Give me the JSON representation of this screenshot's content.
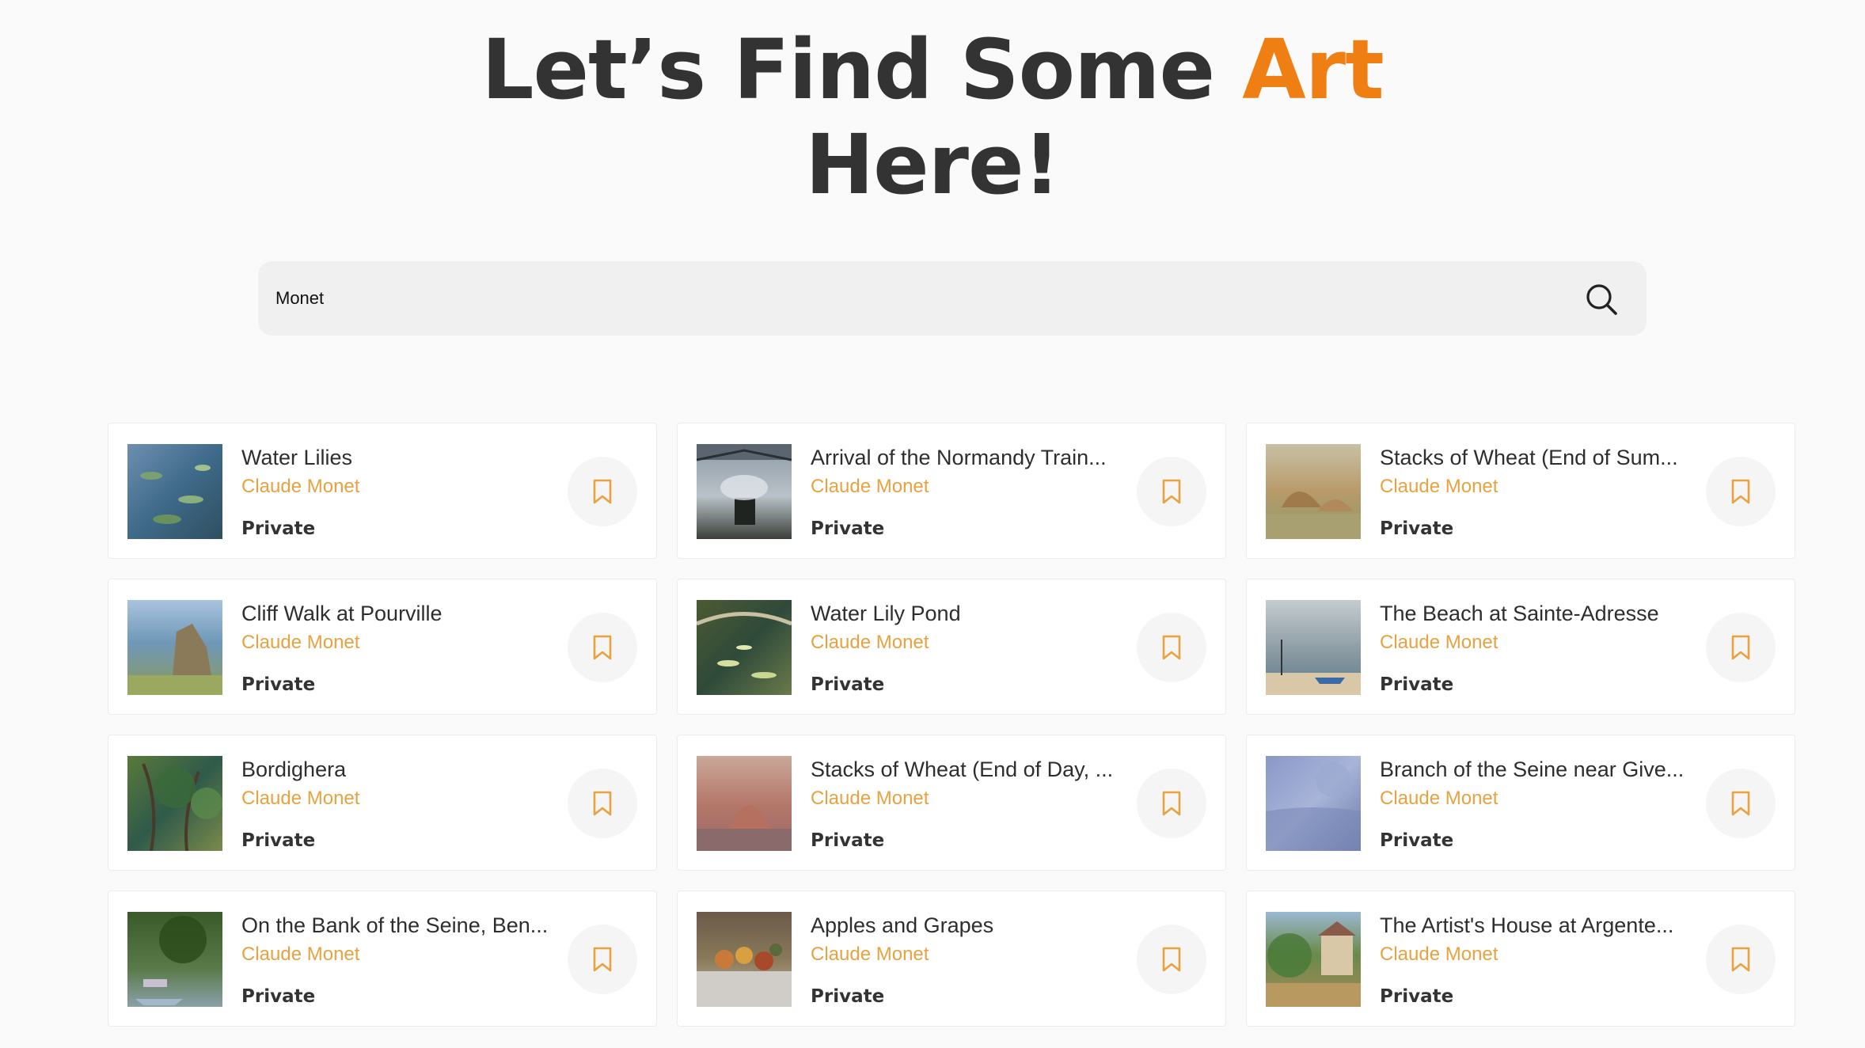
{
  "hero": {
    "line1_prefix": "Let’s Find Some ",
    "line1_accent": "Art",
    "line2": "Here!"
  },
  "search": {
    "value": "Monet",
    "placeholder": ""
  },
  "colors": {
    "accent": "#f07f13",
    "artist": "#e8a240",
    "text": "#333333",
    "background": "#fafafa",
    "search_bg": "#f0f0f0"
  },
  "icons": {
    "search": "search-icon",
    "bookmark": "bookmark-icon"
  },
  "results": [
    {
      "title": "Water Lilies",
      "artist": "Claude Monet",
      "status": "Private"
    },
    {
      "title": "Arrival of the Normandy Train...",
      "artist": "Claude Monet",
      "status": "Private"
    },
    {
      "title": "Stacks of Wheat (End of Sum...",
      "artist": "Claude Monet",
      "status": "Private"
    },
    {
      "title": "Cliff Walk at Pourville",
      "artist": "Claude Monet",
      "status": "Private"
    },
    {
      "title": "Water Lily Pond",
      "artist": "Claude Monet",
      "status": "Private"
    },
    {
      "title": "The Beach at Sainte-Adresse",
      "artist": "Claude Monet",
      "status": "Private"
    },
    {
      "title": "Bordighera",
      "artist": "Claude Monet",
      "status": "Private"
    },
    {
      "title": "Stacks of Wheat (End of Day, ...",
      "artist": "Claude Monet",
      "status": "Private"
    },
    {
      "title": "Branch of the Seine near Give...",
      "artist": "Claude Monet",
      "status": "Private"
    },
    {
      "title": "On the Bank of the Seine, Ben...",
      "artist": "Claude Monet",
      "status": "Private"
    },
    {
      "title": "Apples and Grapes",
      "artist": "Claude Monet",
      "status": "Private"
    },
    {
      "title": "The Artist's House at Argente...",
      "artist": "Claude Monet",
      "status": "Private"
    }
  ]
}
